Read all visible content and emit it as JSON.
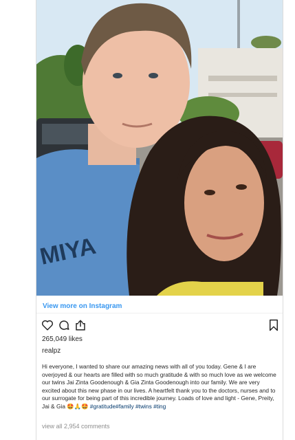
{
  "post": {
    "view_more": "View more on Instagram",
    "likes": "265,049 likes",
    "username": "realpz",
    "caption": "Hi everyone, I wanted to share our amazing news with all of you today. Gene & I are overjoyed & our hearts are filled with so much gratitude & with so much love as we welcome our twins Jai Zinta Goodenough & Gia Zinta Goodenough into our family. We are very excited about this new phase in our lives. A heartfelt thank you to the doctors, nurses and to our surrogate for being part of this incredible journey. Loads of love and light - Gene, Preity, Jai & Gia 🤩🙏🤩 ",
    "hashtags": "#gratitude#family #twins #ting",
    "comments": "view all 2,954 comments"
  },
  "icons": [
    "heart-icon",
    "comment-icon",
    "share-icon",
    "bookmark-icon"
  ],
  "colors": {
    "link": "#3897f0",
    "hashtag": "#00376b",
    "muted": "#8e8e8e",
    "border": "#dbdbdb"
  }
}
